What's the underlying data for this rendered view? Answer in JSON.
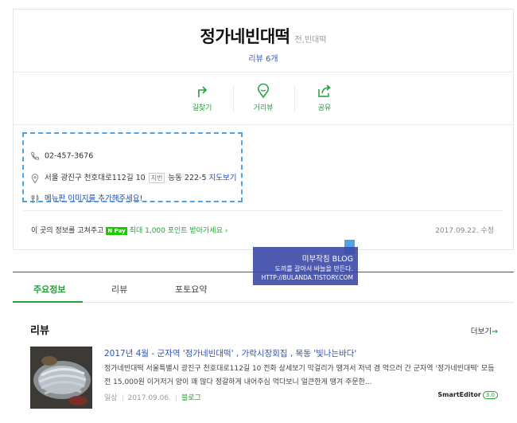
{
  "place": {
    "name": "정가네빈대떡",
    "category": "전,빈대떡",
    "review_count": "리뷰 6개"
  },
  "actions": [
    {
      "label": "길찾기",
      "icon": "directions-icon"
    },
    {
      "label": "거리뷰",
      "icon": "street-view-icon"
    },
    {
      "label": "공유",
      "icon": "share-icon"
    }
  ],
  "info": {
    "phone": "02-457-3676",
    "address": "서울 광진구 천호대로112길 10",
    "jibun_tag": "지번",
    "jibun": "능동 222-5",
    "map_link": "지도보기",
    "menu_prompt": "메뉴판 이미지를 추가해주세요!"
  },
  "fix": {
    "text": "이 곳의 정보를 고쳐주고",
    "npay": "N Pay",
    "reward": "최대 1,000 포인트 받아가세요",
    "reward_arrow": "›",
    "date": "2017.09.22. 수정"
  },
  "watermark": {
    "line1": "미부작침 BLOG",
    "line2": "도끼를 갈아서 바늘을 만든다.",
    "line3": "HTTP://BULANDA.TISTORY.COM"
  },
  "tabs": [
    {
      "label": "주요정보",
      "active": true
    },
    {
      "label": "리뷰",
      "active": false
    },
    {
      "label": "포토요약",
      "active": false
    }
  ],
  "reviews_section": {
    "heading": "리뷰",
    "more": "더보기",
    "more_arrow": "→"
  },
  "post": {
    "title": "2017년 4월 - 군자역 '정가네빈대떡' , 가락시장회집 , 목동 '빛나는바다'",
    "body": "정가네빈대떡 서울특별시 광진구 천호대로112길 10 전화 상세보기 막걸리가 땡겨서 저녁 겸 먹으러 간 군자역 '정가네빈대떡' 모듬전 15,000원 이거저거 양이 꽤 많다 정갈하게 내어주심 먹다보니 얼큰한게 땡겨 주문한...",
    "type": "일상",
    "date": "2017.09.06.",
    "source": "블로그",
    "editor_label": "SmartEditor",
    "editor_version": "3.0"
  },
  "colors": {
    "accent_green": "#23a03a",
    "link_blue": "#2b55b8",
    "selection_dashed": "#4da3e8",
    "overlay": "#3b4aa8"
  }
}
